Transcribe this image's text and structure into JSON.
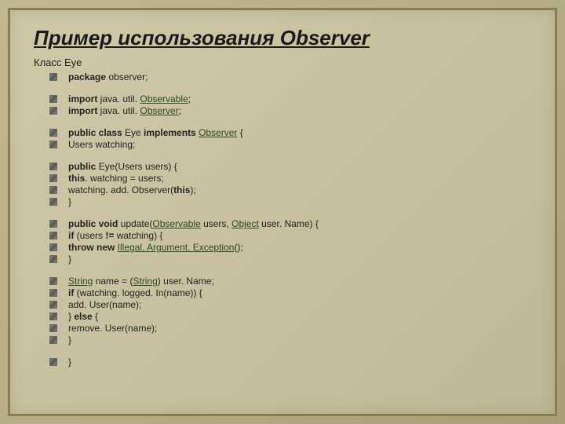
{
  "title": "Пример использования Observer",
  "subtitle": "Класс Eye",
  "lines": [
    {
      "segments": [
        {
          "t": "package ",
          "cls": "kw"
        },
        {
          "t": "observer;",
          "cls": ""
        }
      ]
    },
    {
      "spacer": true
    },
    {
      "segments": [
        {
          "t": "import ",
          "cls": "kw"
        },
        {
          "t": "java. util. ",
          "cls": ""
        },
        {
          "t": "Observable",
          "cls": "link"
        },
        {
          "t": ";",
          "cls": ""
        }
      ]
    },
    {
      "segments": [
        {
          "t": "import ",
          "cls": "kw"
        },
        {
          "t": "java. util. ",
          "cls": ""
        },
        {
          "t": "Observer",
          "cls": "link"
        },
        {
          "t": ";",
          "cls": ""
        }
      ]
    },
    {
      "spacer": true
    },
    {
      "segments": [
        {
          "t": "public class ",
          "cls": "kw"
        },
        {
          "t": "Eye ",
          "cls": ""
        },
        {
          "t": "implements ",
          "cls": "kw"
        },
        {
          "t": "Observer",
          "cls": "link"
        },
        {
          "t": " {",
          "cls": ""
        }
      ]
    },
    {
      "segments": [
        {
          "t": "Users watching;",
          "cls": ""
        }
      ]
    },
    {
      "spacer": true
    },
    {
      "segments": [
        {
          "t": "public ",
          "cls": "kw"
        },
        {
          "t": "Eye(Users users) {",
          "cls": ""
        }
      ]
    },
    {
      "segments": [
        {
          "t": "this",
          "cls": "kw"
        },
        {
          "t": ". watching = users;",
          "cls": ""
        }
      ]
    },
    {
      "segments": [
        {
          "t": "watching. add. Observer(",
          "cls": ""
        },
        {
          "t": "this",
          "cls": "kw"
        },
        {
          "t": ");",
          "cls": ""
        }
      ]
    },
    {
      "segments": [
        {
          "t": "}",
          "cls": ""
        }
      ]
    },
    {
      "spacer": true
    },
    {
      "segments": [
        {
          "t": "public void ",
          "cls": "kw"
        },
        {
          "t": "update(",
          "cls": ""
        },
        {
          "t": "Observable",
          "cls": "link"
        },
        {
          "t": " users, ",
          "cls": ""
        },
        {
          "t": "Object",
          "cls": "link"
        },
        {
          "t": " user. Name) {",
          "cls": ""
        }
      ]
    },
    {
      "segments": [
        {
          "t": "if ",
          "cls": "kw"
        },
        {
          "t": "(users ",
          "cls": ""
        },
        {
          "t": "!= ",
          "cls": "kw"
        },
        {
          "t": "watching) {",
          "cls": ""
        }
      ]
    },
    {
      "segments": [
        {
          "t": "throw new ",
          "cls": "kw"
        },
        {
          "t": "Illegal. Argument. Exception",
          "cls": "link"
        },
        {
          "t": "();",
          "cls": ""
        }
      ]
    },
    {
      "segments": [
        {
          "t": "}",
          "cls": ""
        }
      ]
    },
    {
      "spacer": true
    },
    {
      "segments": [
        {
          "t": "String",
          "cls": "link"
        },
        {
          "t": " name = (",
          "cls": ""
        },
        {
          "t": "String",
          "cls": "link"
        },
        {
          "t": ") user. Name;",
          "cls": ""
        }
      ]
    },
    {
      "segments": [
        {
          "t": "if ",
          "cls": "kw"
        },
        {
          "t": "(watching. logged. In(name)) {",
          "cls": ""
        }
      ]
    },
    {
      "segments": [
        {
          "t": "add. User(name);",
          "cls": ""
        }
      ]
    },
    {
      "segments": [
        {
          "t": "} ",
          "cls": ""
        },
        {
          "t": "else ",
          "cls": "kw"
        },
        {
          "t": "{",
          "cls": ""
        }
      ]
    },
    {
      "segments": [
        {
          "t": "remove. User(name);",
          "cls": ""
        }
      ]
    },
    {
      "segments": [
        {
          "t": "}",
          "cls": ""
        }
      ]
    },
    {
      "spacer": true
    },
    {
      "segments": [
        {
          "t": "}",
          "cls": ""
        }
      ]
    }
  ]
}
